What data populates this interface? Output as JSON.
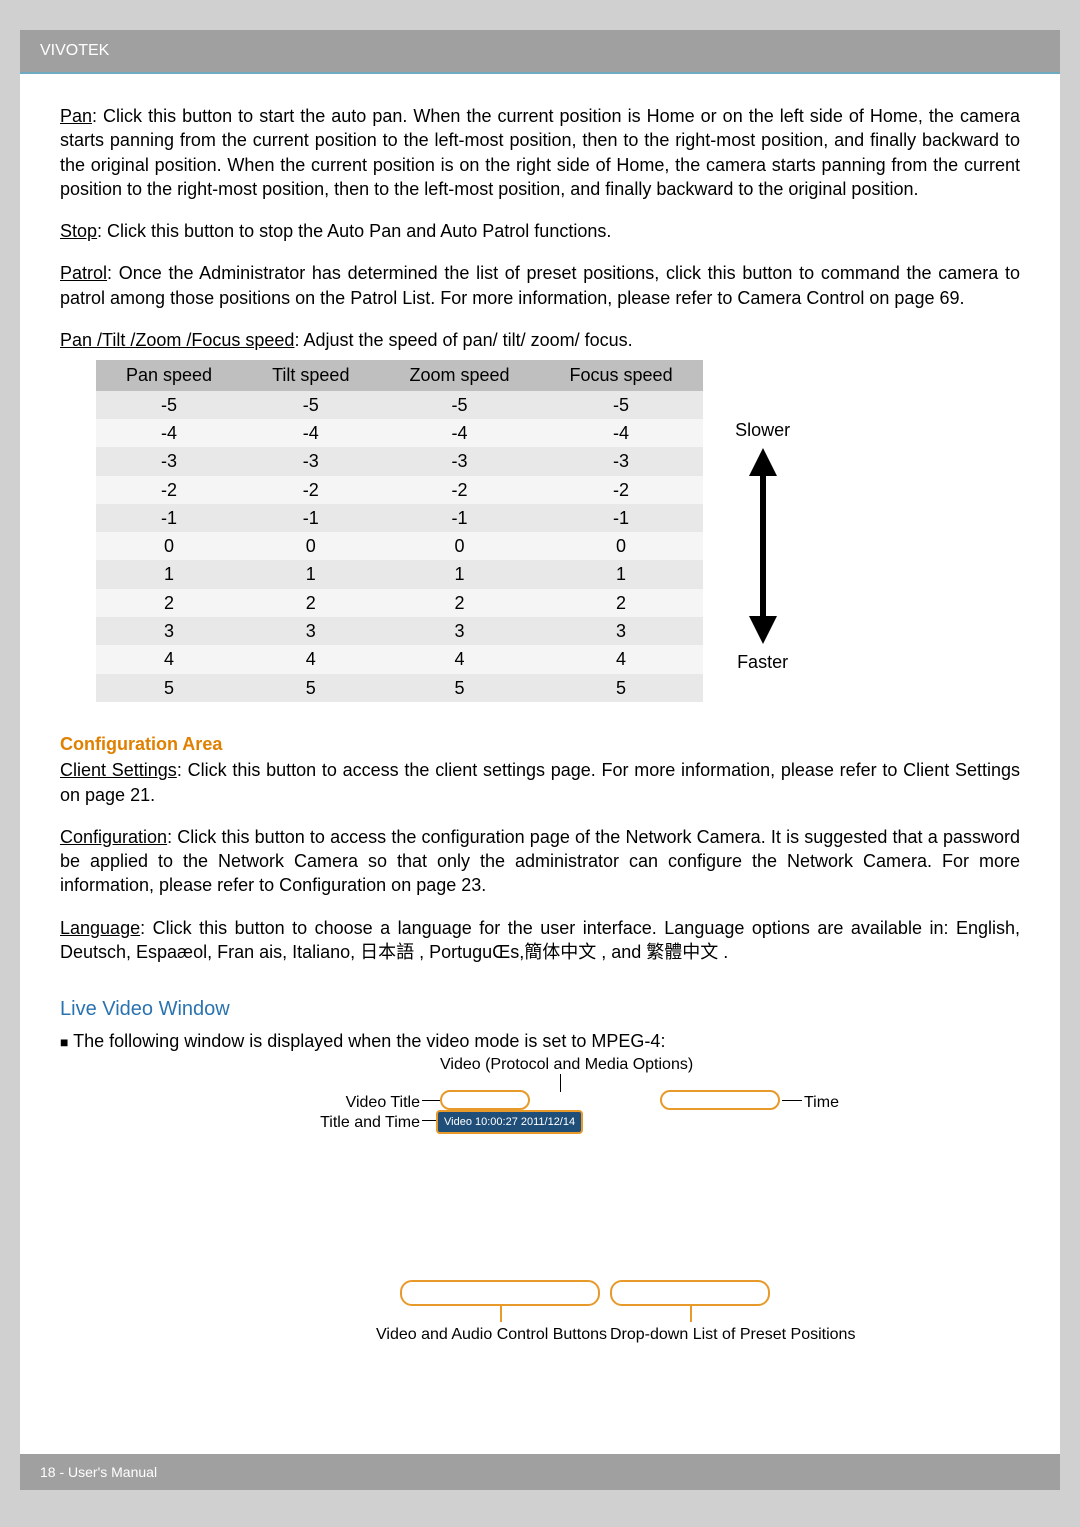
{
  "header": {
    "brand": "VIVOTEK"
  },
  "footer": {
    "text": "18 - User's Manual"
  },
  "paragraphs": {
    "pan_u": "Pan",
    "pan_rest": ": Click this button to start the auto pan. When the current position is Home or on the left side of Home, the camera starts panning from the current position to the left-most position, then to the right-most position, and finally backward to the original position. When the current position is on the right side of Home, the camera starts panning from the current position to the right-most position, then to the left-most position, and finally backward to the original position.",
    "stop_u": "Stop",
    "stop_rest": ": Click this button to stop the Auto Pan and Auto Patrol functions.",
    "patrol_u": "Patrol",
    "patrol_rest": ": Once the Administrator has determined the list of preset positions, click this button to command the camera to patrol among those positions on the Patrol List. For more information, please refer to Camera Control on page 69.",
    "speed_u": "Pan /Tilt /Zoom /Focus speed",
    "speed_rest": ": Adjust the speed of pan/ tilt/ zoom/ focus."
  },
  "speed_table": {
    "headers": [
      "Pan speed",
      "Tilt speed",
      "Zoom speed",
      "Focus speed"
    ],
    "rows": [
      [
        "-5",
        "-5",
        "-5",
        "-5"
      ],
      [
        "-4",
        "-4",
        "-4",
        "-4"
      ],
      [
        "-3",
        "-3",
        "-3",
        "-3"
      ],
      [
        "-2",
        "-2",
        "-2",
        "-2"
      ],
      [
        "-1",
        "-1",
        "-1",
        "-1"
      ],
      [
        "0",
        "0",
        "0",
        "0"
      ],
      [
        "1",
        "1",
        "1",
        "1"
      ],
      [
        "2",
        "2",
        "2",
        "2"
      ],
      [
        "3",
        "3",
        "3",
        "3"
      ],
      [
        "4",
        "4",
        "4",
        "4"
      ],
      [
        "5",
        "5",
        "5",
        "5"
      ]
    ],
    "slower": "Slower",
    "faster": "Faster"
  },
  "config": {
    "heading": "Configuration Area",
    "client_u": "Client Settings",
    "client_rest": ": Click this button to access the client settings page. For more information, please refer to Client Settings on page 21.",
    "conf_u": "Configuration",
    "conf_rest": ": Click this button to access the configuration page of the Network Camera. It is suggested that a password be applied to the Network Camera so that only the administrator can configure the Network Camera. For more information, please refer to Configuration on page 23.",
    "lang_u": "Language",
    "lang_rest": ": Click this button to choose a language for the user interface. Language options are available in: English, Deutsch, Espaæol, Fran ais, Italiano, 日本語 , PortuguŒs,簡体中文 , and 繁體中文 ."
  },
  "live": {
    "heading": "Live Video Window",
    "intro": " The following window is displayed when the video mode is set to MPEG-4:",
    "caption_top": "Video (Protocol and Media Options)",
    "label_video_title": "Video Title",
    "label_title_time": "Title and Time",
    "label_time": "Time",
    "video_overlay": "Video 10:00:27 2011/12/14",
    "label_controls": "Video and Audio Control Buttons",
    "label_dropdown": "Drop-down List of Preset Positions"
  }
}
